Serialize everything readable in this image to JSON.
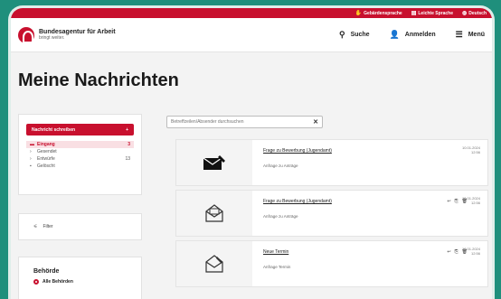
{
  "topbar": {
    "items": [
      {
        "label": "Gebärdensprache",
        "icon": "hand-icon"
      },
      {
        "label": "Leichte Sprache",
        "icon": "book-icon"
      },
      {
        "label": "Deutsch",
        "icon": "globe-icon"
      }
    ]
  },
  "header": {
    "logo_title": "Bundesagentur für Arbeit",
    "logo_sub": "bringt weiter.",
    "nav": [
      {
        "label": "Suche",
        "icon": "search-icon"
      },
      {
        "label": "Anmelden",
        "icon": "user-icon"
      },
      {
        "label": "Menü",
        "icon": "menu-icon"
      }
    ]
  },
  "page_title": "Meine Nachrichten",
  "sidebar": {
    "new_message_label": "Nachricht schreiben",
    "folders": [
      {
        "label": "Eingang",
        "count": "3"
      },
      {
        "label": "Gesendet",
        "count": ""
      },
      {
        "label": "Entwürfe",
        "count": "13"
      },
      {
        "label": "Gelöscht",
        "count": ""
      }
    ],
    "filter_label": "Filter",
    "behoerde_title": "Behörde",
    "behoerde_option": "Alle Behörden"
  },
  "search": {
    "placeholder": "Betreffzeilen/Absender durchsuchen"
  },
  "messages": [
    {
      "subject": "Frage zu Bewerbung (Jugendamt)",
      "from": "Anfrage zu Anträge",
      "date": "10.01.2024",
      "time": "12:56"
    },
    {
      "subject": "Frage zu Bewerbung (Jugendamt)",
      "from": "Anfrage zu Anträge",
      "date": "10.01.2024",
      "time": "12:56"
    },
    {
      "subject": "Neue Termin",
      "from": "Anfrage Termin",
      "date": "10.01.2024",
      "time": "12:56"
    }
  ],
  "colors": {
    "brand_red": "#c8102e",
    "frame_teal": "#1f8f7c"
  }
}
